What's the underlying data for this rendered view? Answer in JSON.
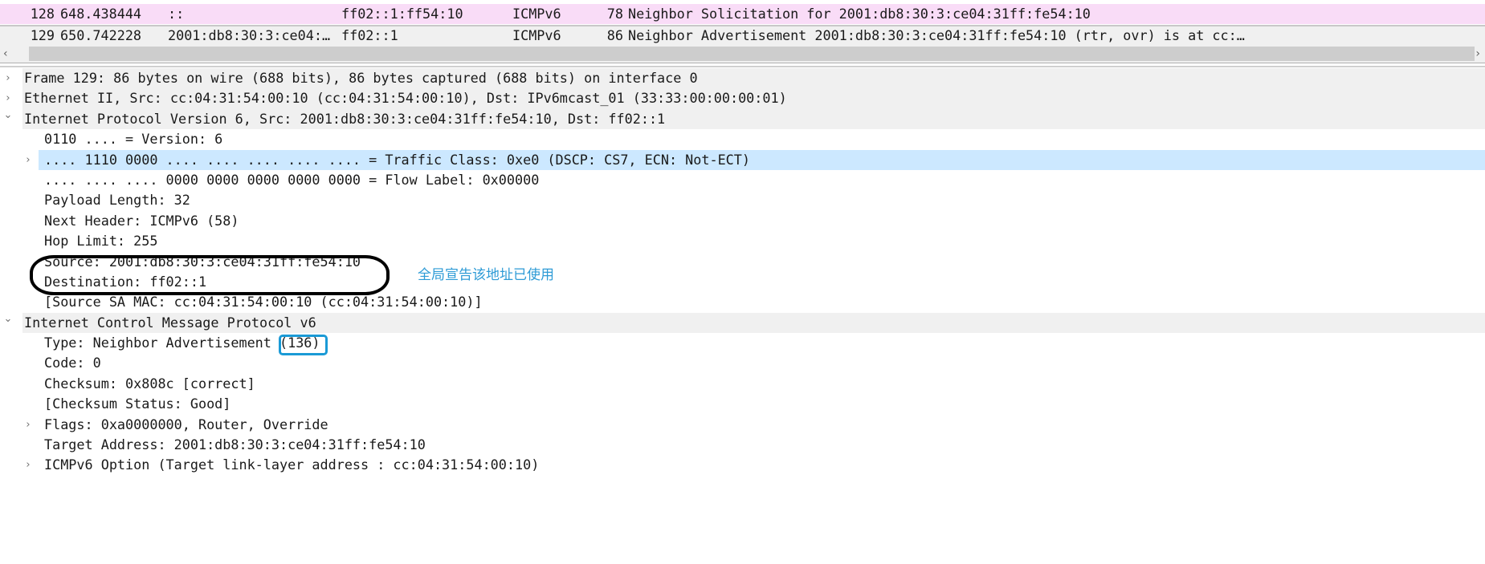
{
  "packet_list": {
    "rows": [
      {
        "no": "128",
        "time": "648.438444",
        "source": "::",
        "destination": "ff02::1:ff54:10",
        "protocol": "ICMPv6",
        "length": "78",
        "info": "Neighbor Solicitation for 2001:db8:30:3:ce04:31ff:fe54:10",
        "color": "#f9dcf7"
      },
      {
        "no": "129",
        "time": "650.742228",
        "source": "2001:db8:30:3:ce04:…",
        "destination": "ff02::1",
        "protocol": "ICMPv6",
        "length": "86",
        "info": "Neighbor Advertisement 2001:db8:30:3:ce04:31ff:fe54:10 (rtr, ovr) is at cc:…",
        "selected": true
      }
    ],
    "scroll_left": "‹",
    "scroll_right": "›"
  },
  "details": [
    {
      "level": 0,
      "expand": "collapsed",
      "text": "Frame 129: 86 bytes on wire (688 bits), 86 bytes captured (688 bits) on interface 0"
    },
    {
      "level": 0,
      "expand": "collapsed",
      "text": "Ethernet II, Src: cc:04:31:54:00:10 (cc:04:31:54:00:10), Dst: IPv6mcast_01 (33:33:00:00:00:01)"
    },
    {
      "level": 0,
      "expand": "expanded",
      "text": "Internet Protocol Version 6, Src: 2001:db8:30:3:ce04:31ff:fe54:10, Dst: ff02::1"
    },
    {
      "level": 1,
      "expand": "none",
      "text": "0110 .... = Version: 6"
    },
    {
      "level": 1,
      "expand": "collapsed",
      "text": ".... 1110 0000 .... .... .... .... .... = Traffic Class: 0xe0 (DSCP: CS7, ECN: Not-ECT)",
      "selected": true
    },
    {
      "level": 1,
      "expand": "none",
      "text": ".... .... .... 0000 0000 0000 0000 0000 = Flow Label: 0x00000"
    },
    {
      "level": 1,
      "expand": "none",
      "text": "Payload Length: 32"
    },
    {
      "level": 1,
      "expand": "none",
      "text": "Next Header: ICMPv6 (58)"
    },
    {
      "level": 1,
      "expand": "none",
      "text": "Hop Limit: 255"
    },
    {
      "level": 1,
      "expand": "none",
      "text": "Source: 2001:db8:30:3:ce04:31ff:fe54:10"
    },
    {
      "level": 1,
      "expand": "none",
      "text": "Destination: ff02::1"
    },
    {
      "level": 1,
      "expand": "none",
      "text": "[Source SA MAC: cc:04:31:54:00:10 (cc:04:31:54:00:10)]"
    },
    {
      "level": 0,
      "expand": "expanded",
      "text": "Internet Control Message Protocol v6"
    },
    {
      "level": 1,
      "expand": "none",
      "text": "Type: Neighbor Advertisement (136)"
    },
    {
      "level": 1,
      "expand": "none",
      "text": "Code: 0"
    },
    {
      "level": 1,
      "expand": "none",
      "text": "Checksum: 0x808c [correct]"
    },
    {
      "level": 1,
      "expand": "none",
      "text": "[Checksum Status: Good]"
    },
    {
      "level": 1,
      "expand": "collapsed",
      "text": "Flags: 0xa0000000, Router, Override"
    },
    {
      "level": 1,
      "expand": "none",
      "text": "Target Address: 2001:db8:30:3:ce04:31ff:fe54:10"
    },
    {
      "level": 1,
      "expand": "collapsed",
      "text": "ICMPv6 Option (Target link-layer address : cc:04:31:54:00:10)"
    }
  ],
  "annotation": {
    "note": "全局宣告该地址已使用",
    "ellipse_color": "#000000",
    "note_color": "#2e9bd6",
    "box_color": "#1a9ad6"
  }
}
